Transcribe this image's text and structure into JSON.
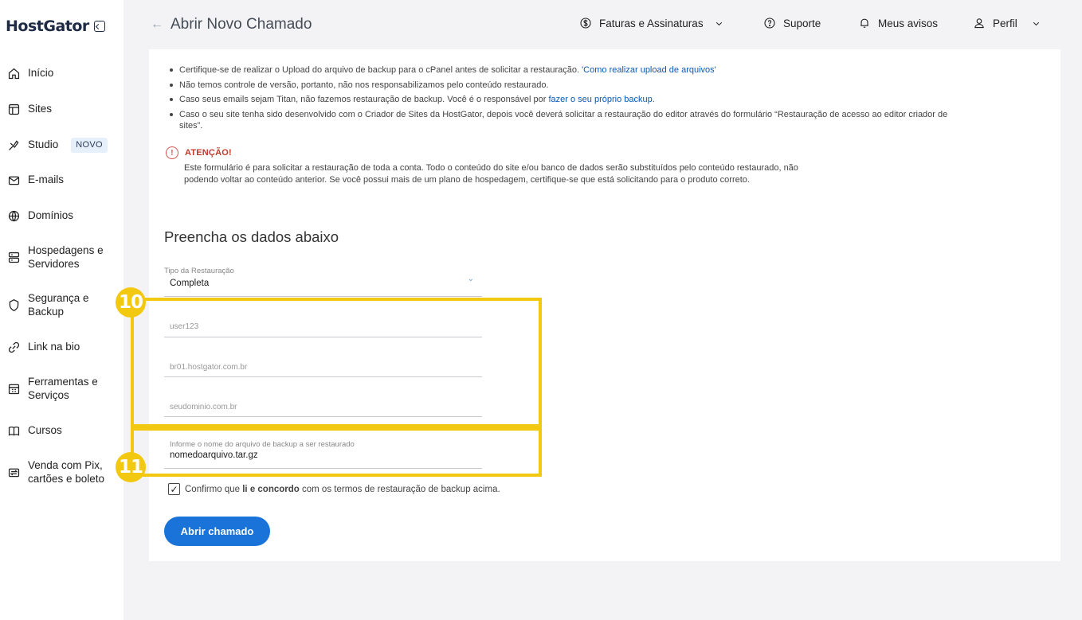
{
  "brand": {
    "name": "HostGator"
  },
  "sidebar": {
    "items": [
      {
        "label": "Início",
        "icon": "home-icon"
      },
      {
        "label": "Sites",
        "icon": "layout-icon"
      },
      {
        "label": "Studio",
        "icon": "brush-icon",
        "badge": "NOVO"
      },
      {
        "label": "E-mails",
        "icon": "mail-icon"
      },
      {
        "label": "Domínios",
        "icon": "globe-icon"
      },
      {
        "label": "Hospedagens e Servidores",
        "icon": "server-icon"
      },
      {
        "label": "Segurança e Backup",
        "icon": "shield-icon"
      },
      {
        "label": "Link na bio",
        "icon": "link-icon"
      },
      {
        "label": "Ferramentas e Serviços",
        "icon": "tools-icon"
      },
      {
        "label": "Cursos",
        "icon": "book-icon"
      },
      {
        "label": "Venda com Pix, cartões e boleto",
        "icon": "transfer-icon"
      }
    ]
  },
  "header": {
    "title": "Abrir Novo Chamado",
    "nav": [
      {
        "label": "Faturas e Assinaturas",
        "icon": "dollar-circle-icon",
        "dropdown": true
      },
      {
        "label": "Suporte",
        "icon": "help-circle-icon",
        "dropdown": false
      },
      {
        "label": "Meus avisos",
        "icon": "bell-icon",
        "dropdown": false
      },
      {
        "label": "Perfil",
        "icon": "user-icon",
        "dropdown": true
      }
    ]
  },
  "notes": {
    "b1_text": "Certifique-se de realizar o Upload do arquivo de backup para o cPanel antes de solicitar a restauração. ",
    "b1_link": "'Como realizar upload de arquivos'",
    "b2_text": "Não temos controle de versão, portanto, não nos responsabilizamos pelo conteúdo restaurado.",
    "b3_text": "Caso seus emails sejam Titan, não fazemos restauração de backup. Você é o responsável por ",
    "b3_link": "fazer o seu próprio backup",
    "b3_end": ".",
    "b4_text": "Caso o seu site tenha sido desenvolvido com o Criador de Sites da HostGator, depois você deverá solicitar a restauração do editor através do formulário “Restauração de acesso ao editor criador de",
    "b4_cont": "sites”."
  },
  "attention": {
    "title": "ATENÇÃO!",
    "text": "Este formulário é para solicitar a restauração de toda a conta. Todo o conteúdo do site e/ou banco de dados serão substituídos pelo conteúdo restaurado, não podendo voltar ao conteúdo anterior. Se você possui mais de um plano de hospedagem, certifique-se que está solicitando para o produto correto."
  },
  "form": {
    "section_title": "Preencha os dados abaixo",
    "type_label": "Tipo da Restauração",
    "type_value": "Completa",
    "user_placeholder": "user123",
    "server_placeholder": "br01.hostgator.com.br",
    "domain_placeholder": "seudominio.com.br",
    "file_label": "Informe o nome do arquivo de backup a ser restaurado",
    "file_value": "nomedoarquivo.tar.gz",
    "confirm_pre": "Confirmo que ",
    "confirm_bold": "li e concordo",
    "confirm_post": " com os termos de restauração de backup acima.",
    "submit_label": "Abrir chamado"
  },
  "annotations": {
    "step_a": "10",
    "step_b": "11",
    "highlight_color": "#f2c811"
  }
}
